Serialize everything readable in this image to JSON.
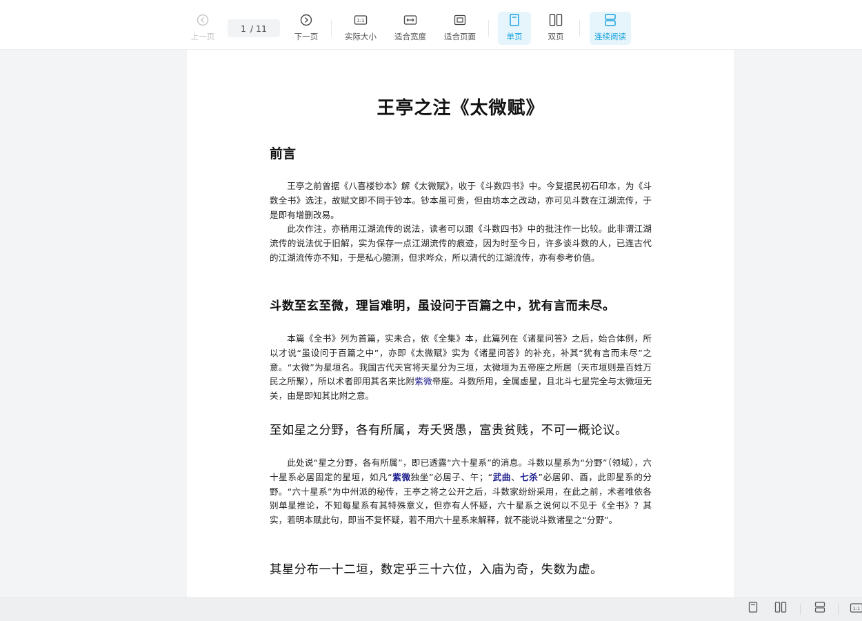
{
  "toolbar": {
    "prev_label": "上一页",
    "next_label": "下一页",
    "current_page": "1",
    "page_total": "/ 11",
    "actual_size_label": "实际大小",
    "fit_width_label": "适合宽度",
    "fit_page_label": "适合页面",
    "single_page_label": "单页",
    "double_page_label": "双页",
    "continuous_label": "连续阅读"
  },
  "document": {
    "title": "王亭之注《太微赋》",
    "preface_heading": "前言",
    "preface_p1": "王亭之前曾据《八喜楼钞本》解《太微赋》，收于《斗数四书》中。今复据民初石印本，为《斗数全书》选注，故赋文即不同于钞本。钞本虽可贵，但由坊本之改动，亦可见斗数在江湖流传，于是即有增删改易。",
    "preface_p2": "此次作注，亦稍用江湖流传的说法，读者可以跟《斗数四书》中的批注作一比较。此非谓江湖流传的说法优于旧解，实为保存一点江湖流传的痕迹，因为时至今日，许多谈斗数的人，已连古代的江湖流传亦不知，于是私心臆测，但求哗众，所以清代的江湖流传，亦有参考价值。",
    "verse1": "斗数至玄至微，理旨难明，虽设问于百篇之中，犹有言而未尽。",
    "note1_a": "本篇《全书》列为首篇，实未合，依《全集》本，此篇列在《诸星问答》之后，始合体例，所以才说“虽设问于百篇之中”，亦即《太微赋》实为《诸星问答》的补充，补其“犹有言而未尽”之意。“太微”为星垣名。我国古代天官将天星分为三垣，太微垣为五帝座之所居（天市垣则是百姓万民之所聚），所以术者即用其名来比附",
    "note1_hl": "紫微",
    "note1_b": "帝座。斗数所用，全属虚星，且北斗七星完全与太微垣无关，由是即知其比附之意。",
    "verse2": "至如星之分野，各有所属，寿夭贤愚，富贵贫贱，不可一概论议。",
    "note2_a": "此处说“星之分野，各有所属”，即已透露“六十星系”的消息。斗数以星系为“分野”（领域），六十星系必居固定的星垣，如凡“",
    "note2_hl1": "紫微",
    "note2_b": "独坐”必居子、午；“",
    "note2_hl2": "武曲",
    "note2_sep": "、",
    "note2_hl3": "七杀",
    "note2_c": "”必居卯、酉，此即星系的分野。“六十星系”为中州派的秘传，王亭之将之公开之后，斗数家纷纷采用，在此之前，术者唯依各别单星推论，不知每星系有其特殊意义，但亦有人怀疑，六十星系之说何以不见于《全书》？其实，若明本赋此句，即当不复怀疑，若不用六十星系来解释，就不能说斗数诸星之“分野”。",
    "verse3": "其星分布一十二垣，数定乎三十六位，入庙为奇，失数为虚。"
  },
  "colors": {
    "accent": "#1aa3e0",
    "highlight_text": "#1a1a8c",
    "background": "#f3f4f6"
  }
}
